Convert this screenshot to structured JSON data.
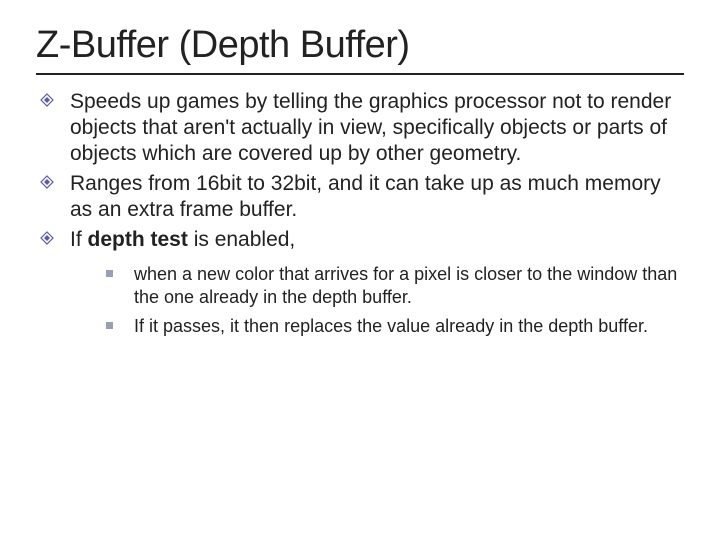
{
  "title": "Z-Buffer (Depth Buffer)",
  "bullets": {
    "b1": "Speeds up games by telling the graphics processor not to render objects that aren't actually in view, specifically objects or parts of objects which are covered up by other geometry.",
    "b2": "Ranges from 16bit to 32bit, and it can take up as much memory as an extra frame buffer.",
    "b3_prefix": "If ",
    "b3_bold": "depth test",
    "b3_suffix": " is enabled,"
  },
  "subbullets": {
    "s1": "when a new color that arrives for a pixel is closer to the window than the one already in the depth buffer.",
    "s2": "If it passes, it then replaces the value already in the depth buffer."
  },
  "colors": {
    "bullet_purple": "#5a5aa8",
    "bullet_square": "#9aa0b4",
    "rule": "#222222"
  }
}
